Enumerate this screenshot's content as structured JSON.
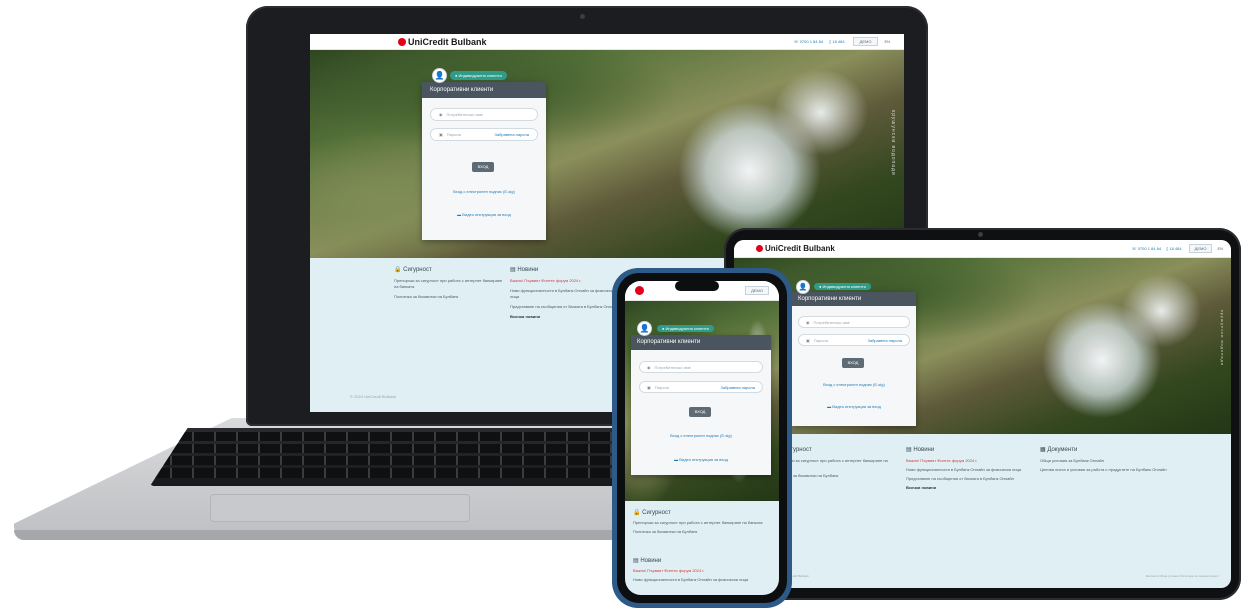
{
  "brand": {
    "name": "UniCredit Bulbank",
    "accent": "#e2001a",
    "link_color": "#1e7ab8"
  },
  "header": {
    "phone_contact": "0700 1 84 84",
    "short_code": "18 484",
    "demo_label": "ДЕМО",
    "lang_label": "EN"
  },
  "hero": {
    "vertical_caption": "крушунски водопади"
  },
  "login": {
    "badge": "Индивидуални клиенти",
    "title": "Корпоративни клиенти",
    "username_placeholder": "Потребителско име",
    "password_placeholder": "Парола",
    "forgot_link": "Забравена парола",
    "enter_button": "ВХОД",
    "cert_link": "Вход с електронен подпис (Е-sig)",
    "video_link": "Видео инструкция за вход"
  },
  "security": {
    "title": "Сигурност",
    "items": [
      "Препоръки за сигурност при работа с интернет банкиране на банката",
      "Политика за бисквитки на Булбанк"
    ]
  },
  "news": {
    "title": "Новини",
    "items": [
      "Важно! Първият Финтех форум 2024 г.",
      "Нови функционалности в Булбанк Онлайн за физически лица",
      "Представяне на съобщения от банката в Булбанк Онлайн"
    ],
    "all_news": "Всички новини"
  },
  "documents": {
    "title": "Документи",
    "items": [
      "Общи условия за Булбанк Онлайн",
      "Ценова листа и условия за работа с продуктите на Булбанк Онлайн"
    ]
  },
  "footer": {
    "copyright": "© 2024 UniCredit Bulbank",
    "links": "Контакти     Общи условия     Политика за поверителност"
  }
}
